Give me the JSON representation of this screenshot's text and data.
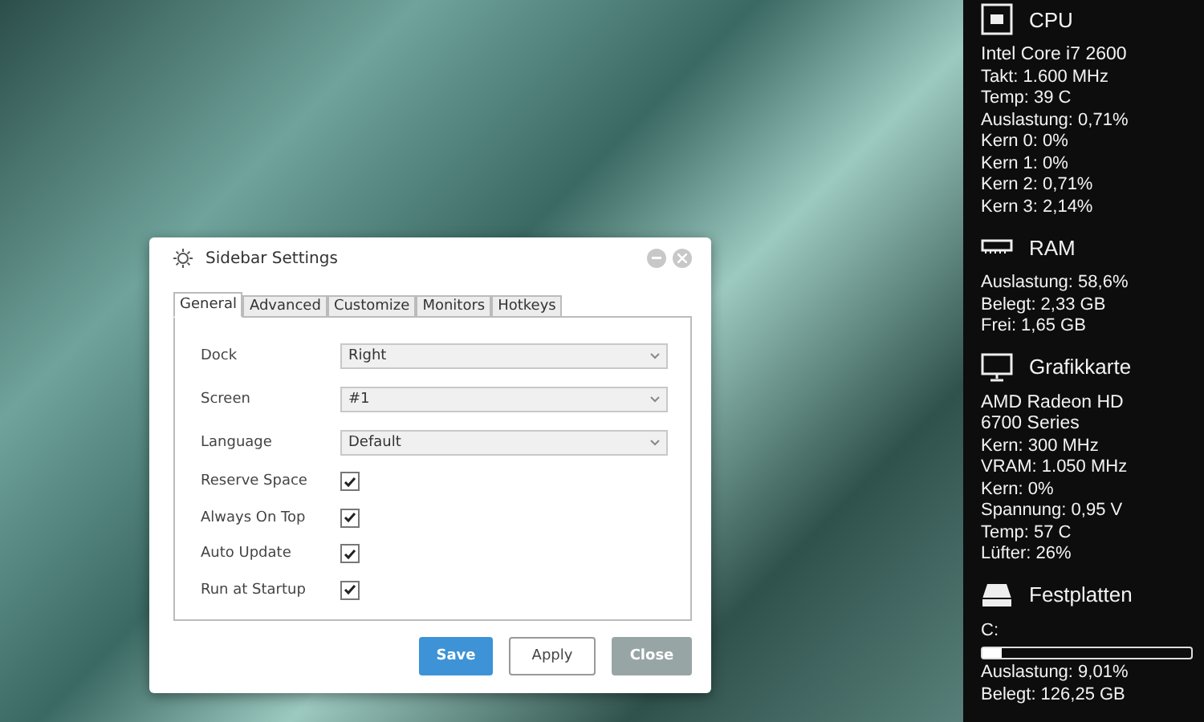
{
  "dialog": {
    "title": "Sidebar Settings",
    "tabs": [
      {
        "label": "General",
        "selected": true
      },
      {
        "label": "Advanced",
        "selected": false
      },
      {
        "label": "Customize",
        "selected": false
      },
      {
        "label": "Monitors",
        "selected": false
      },
      {
        "label": "Hotkeys",
        "selected": false
      }
    ],
    "dropdowns": [
      {
        "label": "Dock",
        "value": "Right"
      },
      {
        "label": "Screen",
        "value": "#1"
      },
      {
        "label": "Language",
        "value": "Default"
      }
    ],
    "checkboxes": [
      {
        "label": "Reserve Space",
        "checked": true
      },
      {
        "label": "Always On Top",
        "checked": true
      },
      {
        "label": "Auto Update",
        "checked": true
      },
      {
        "label": "Run at Startup",
        "checked": true
      }
    ],
    "buttons": [
      {
        "label": "Save",
        "kind": "primary"
      },
      {
        "label": "Apply",
        "kind": "outline"
      },
      {
        "label": "Close",
        "kind": "muted"
      }
    ]
  },
  "sidebar": {
    "sections": [
      {
        "kind": "cpu",
        "title": "CPU",
        "rows": [
          {
            "kind": "name",
            "text": "Intel Core i7 2600"
          },
          {
            "kind": "text",
            "text": "Takt: 1.600 MHz"
          },
          {
            "kind": "text",
            "text": "Temp: 39 C"
          },
          {
            "kind": "text",
            "text": "Auslastung: 0,71%"
          },
          {
            "kind": "text",
            "text": "Kern 0: 0%"
          },
          {
            "kind": "text",
            "text": "Kern 1: 0%"
          },
          {
            "kind": "text",
            "text": "Kern 2: 0,71%"
          },
          {
            "kind": "text",
            "text": "Kern 3: 2,14%"
          }
        ]
      },
      {
        "kind": "ram",
        "title": "RAM",
        "rows": [
          {
            "kind": "text",
            "text": "Auslastung: 58,6%"
          },
          {
            "kind": "text",
            "text": "Belegt: 2,33 GB"
          },
          {
            "kind": "text",
            "text": "Frei: 1,65 GB"
          }
        ]
      },
      {
        "kind": "gpu",
        "title": "Grafikkarte",
        "rows": [
          {
            "kind": "name",
            "text": "AMD Radeon HD"
          },
          {
            "kind": "name",
            "text": "6700 Series"
          },
          {
            "kind": "text",
            "text": "Kern: 300 MHz"
          },
          {
            "kind": "text",
            "text": "VRAM: 1.050 MHz"
          },
          {
            "kind": "text",
            "text": "Kern: 0%"
          },
          {
            "kind": "text",
            "text": "Spannung: 0,95 V"
          },
          {
            "kind": "text",
            "text": "Temp: 57 C"
          },
          {
            "kind": "text",
            "text": "Lüfter: 26%"
          }
        ]
      },
      {
        "kind": "disk",
        "title": "Festplatten",
        "rows": [
          {
            "kind": "text",
            "text": "C:"
          },
          {
            "kind": "bar",
            "level": 0.09
          },
          {
            "kind": "text",
            "text": "Auslastung: 9,01%"
          },
          {
            "kind": "text",
            "text": "Belegt: 126,25 GB"
          }
        ]
      }
    ]
  }
}
